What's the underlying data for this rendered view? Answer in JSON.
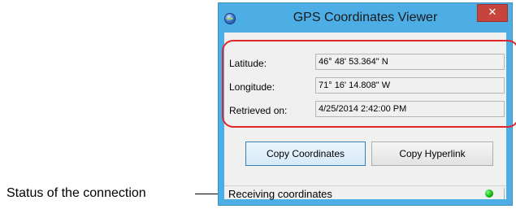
{
  "callout": {
    "label": "Status of the connection"
  },
  "window": {
    "title": "GPS Coordinates Viewer",
    "close_label": "✕"
  },
  "fields": {
    "latitude_label": "Latitude:",
    "latitude_value": "46° 48' 53.364\" N",
    "longitude_label": "Longitude:",
    "longitude_value": "71° 16' 14.808\" W",
    "retrieved_label": "Retrieved on:",
    "retrieved_value": "4/25/2014 2:42:00 PM"
  },
  "buttons": {
    "copy_coordinates": "Copy Coordinates",
    "copy_hyperlink": "Copy Hyperlink"
  },
  "status": {
    "text": "Receiving coordinates",
    "indicator": "connected",
    "indicator_color": "#12b412"
  },
  "colors": {
    "title_bar": "#4daee6",
    "close_button": "#c7443c",
    "highlight_outline": "#e0252b"
  },
  "icons": {
    "app": "globe-icon",
    "close": "close-icon",
    "status": "status-led-icon"
  }
}
